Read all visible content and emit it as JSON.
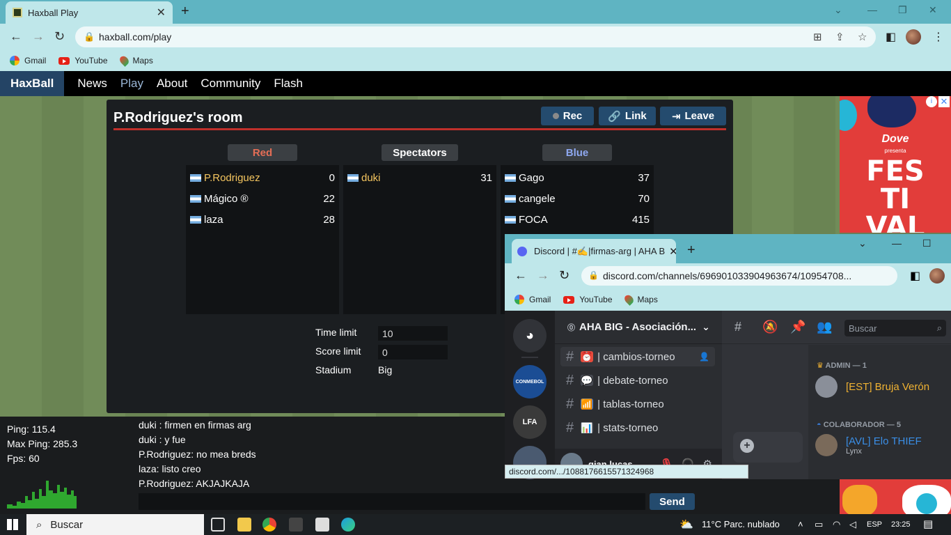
{
  "browser": {
    "tab_title": "Haxball Play",
    "url": "haxball.com/play",
    "bookmarks": [
      "Gmail",
      "YouTube",
      "Maps"
    ]
  },
  "haxball_nav": {
    "logo": "HaxBall",
    "links": [
      "News",
      "Play",
      "About",
      "Community",
      "Flash"
    ],
    "active": "Play"
  },
  "room": {
    "title": "P.Rodriguez's room",
    "buttons": {
      "rec": "Rec",
      "link": "Link",
      "leave": "Leave"
    },
    "teams": {
      "red": {
        "label": "Red",
        "players": [
          {
            "name": "P.Rodriguez",
            "score": "0"
          },
          {
            "name": "Mágico ®",
            "score": "22"
          },
          {
            "name": "laza",
            "score": "28"
          }
        ]
      },
      "spectators": {
        "label": "Spectators",
        "players": [
          {
            "name": "duki",
            "score": "31"
          }
        ]
      },
      "blue": {
        "label": "Blue",
        "players": [
          {
            "name": "Gago",
            "score": "37"
          },
          {
            "name": "cangele",
            "score": "70"
          },
          {
            "name": "FOCA",
            "score": "415"
          }
        ]
      }
    },
    "settings": {
      "time_limit_label": "Time limit",
      "time_limit": "10",
      "score_limit_label": "Score limit",
      "score_limit": "0",
      "stadium_label": "Stadium",
      "stadium": "Big"
    }
  },
  "stats": {
    "ping": "Ping: 115.4",
    "max_ping": "Max Ping: 285.3",
    "fps": "Fps: 60"
  },
  "chat": {
    "messages": [
      "duki : firmen en firmas arg",
      "duki : y fue",
      "P.Rodriguez: no mea breds",
      "laza: listo creo",
      "P.Rodriguez: AKJAJKAJA"
    ],
    "send_label": "Send"
  },
  "ad": {
    "brand": "Dove",
    "sub": "presenta",
    "headline": [
      "FES",
      "TI",
      "VAL"
    ],
    "close": "✕",
    "info": "i"
  },
  "discord": {
    "tab_title": "Discord | #✍️|firmas-arg | AHA B",
    "url": "discord.com/channels/696901033904963674/10954708...",
    "bookmarks": [
      "Gmail",
      "YouTube",
      "Maps"
    ],
    "guild_name": "AHA BIG - Asociación...",
    "channels": [
      {
        "name": "| cambios-torneo",
        "emoji": "⏰",
        "color": "#e74c3c"
      },
      {
        "name": "| debate-torneo",
        "emoji": "💬",
        "color": "#4a4d55"
      },
      {
        "name": "| tablas-torneo",
        "emoji": "📶",
        "color": "#3a7bd5"
      },
      {
        "name": "| stats-torneo",
        "emoji": "📊",
        "color": "#4a4d55"
      }
    ],
    "servers": [
      {
        "label": "CONMEBOL",
        "color": "#1b4d94"
      },
      {
        "label": "LFA",
        "color": "#3a3a3a"
      }
    ],
    "user_name": "gian lucas",
    "search_placeholder": "Buscar",
    "members": {
      "admin_role": "ADMIN — 1",
      "admin_name": "[EST] Bruja Verón",
      "collab_role": "COLABORADOR — 5",
      "collab_name": "[AVL] Elo THIEF",
      "collab_status": "Lynx"
    },
    "status_url": "discord.com/.../1088176615571324968"
  },
  "taskbar": {
    "search": "Buscar",
    "weather": "11°C  Parc. nublado",
    "lang": "ESP",
    "time": "23:25"
  }
}
